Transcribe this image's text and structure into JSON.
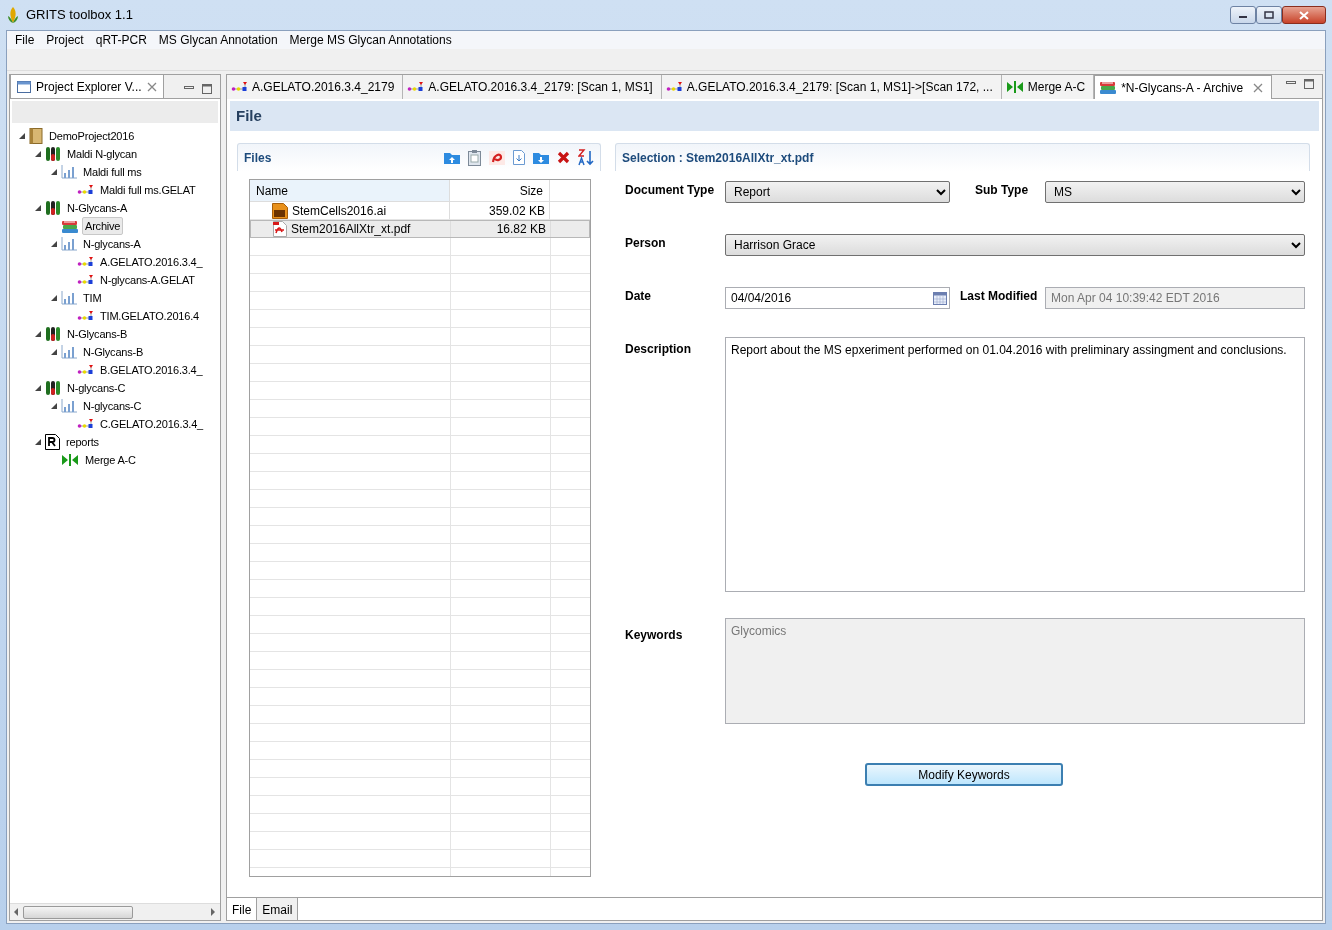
{
  "window": {
    "title": "GRITS toolbox 1.1"
  },
  "menu": [
    "File",
    "Project",
    "qRT-PCR",
    "MS Glycan Annotation",
    "Merge MS Glycan Annotations"
  ],
  "explorer": {
    "title": "Project Explorer V...",
    "tree": [
      {
        "label": "DemoProject2016",
        "kind": "project",
        "expanded": true,
        "selected": false,
        "children": [
          {
            "label": "Maldi N-glycan",
            "kind": "sample",
            "expanded": true,
            "selected": false,
            "children": [
              {
                "label": "Maldi full ms",
                "kind": "chart",
                "expanded": true,
                "selected": false,
                "children": [
                  {
                    "label": "Maldi full ms.GELAT",
                    "kind": "glycan",
                    "selected": false
                  }
                ]
              }
            ]
          },
          {
            "label": "N-Glycans-A",
            "kind": "sample",
            "expanded": true,
            "selected": false,
            "children": [
              {
                "label": "Archive",
                "kind": "archive",
                "selected": true
              },
              {
                "label": "N-glycans-A",
                "kind": "chart",
                "expanded": true,
                "selected": false,
                "children": [
                  {
                    "label": "A.GELATO.2016.3.4_",
                    "kind": "glycan",
                    "selected": false
                  },
                  {
                    "label": "N-glycans-A.GELAT",
                    "kind": "glycan",
                    "selected": false
                  }
                ]
              },
              {
                "label": "TIM",
                "kind": "chart",
                "expanded": true,
                "selected": false,
                "children": [
                  {
                    "label": "TIM.GELATO.2016.4",
                    "kind": "glycan",
                    "selected": false
                  }
                ]
              }
            ]
          },
          {
            "label": "N-Glycans-B",
            "kind": "sample",
            "expanded": true,
            "selected": false,
            "children": [
              {
                "label": "N-Glycans-B",
                "kind": "chart",
                "expanded": true,
                "selected": false,
                "children": [
                  {
                    "label": "B.GELATO.2016.3.4_",
                    "kind": "glycan",
                    "selected": false
                  }
                ]
              }
            ]
          },
          {
            "label": "N-glycans-C",
            "kind": "sample",
            "expanded": true,
            "selected": false,
            "children": [
              {
                "label": "N-glycans-C",
                "kind": "chart",
                "expanded": true,
                "selected": false,
                "children": [
                  {
                    "label": "C.GELATO.2016.3.4_",
                    "kind": "glycan",
                    "selected": false
                  }
                ]
              }
            ]
          },
          {
            "label": "reports",
            "kind": "report",
            "expanded": true,
            "selected": false,
            "children": [
              {
                "label": "Merge A-C",
                "kind": "merge",
                "selected": false
              }
            ]
          }
        ]
      }
    ]
  },
  "editor_tabs": [
    {
      "label": "A.GELATO.2016.3.4_2179",
      "kind": "glycan",
      "selected": false
    },
    {
      "label": "A.GELATO.2016.3.4_2179: [Scan 1, MS1]",
      "kind": "glycan",
      "selected": false
    },
    {
      "label": "A.GELATO.2016.3.4_2179: [Scan 1, MS1]->[Scan 172, ...",
      "kind": "glycan",
      "selected": false
    },
    {
      "label": "Merge A-C",
      "kind": "merge",
      "selected": false
    },
    {
      "label": "*N-Glycans-A - Archive",
      "kind": "archive",
      "selected": true
    }
  ],
  "page_title": "File",
  "files": {
    "title": "Files",
    "columns": [
      "Name",
      "Size"
    ],
    "rows": [
      {
        "name": "StemCells2016.ai",
        "size": "359.02 KB",
        "kind": "ai",
        "selected": false
      },
      {
        "name": "Stem2016AllXtr_xt.pdf",
        "size": "16.82 KB",
        "kind": "pdf",
        "selected": true
      }
    ]
  },
  "selection": {
    "title": "Selection : Stem2016AllXtr_xt.pdf",
    "document_type": {
      "label": "Document Type",
      "value": "Report"
    },
    "sub_type": {
      "label": "Sub Type",
      "value": "MS"
    },
    "person": {
      "label": "Person",
      "value": "Harrison Grace"
    },
    "date": {
      "label": "Date",
      "value": "04/04/2016"
    },
    "last_modified": {
      "label": "Last Modified",
      "value": "Mon Apr 04 10:39:42 EDT 2016",
      "disabled": true
    },
    "description": {
      "label": "Description",
      "value": "Report about the MS epxeriment performed on 01.04.2016 with preliminary assingment and conclusions."
    },
    "keywords": {
      "label": "Keywords",
      "value": "Glycomics",
      "disabled": true
    },
    "button": "Modify Keywords"
  },
  "bottom_tabs": [
    {
      "label": "File",
      "selected": true
    },
    {
      "label": "Email",
      "selected": false
    }
  ]
}
